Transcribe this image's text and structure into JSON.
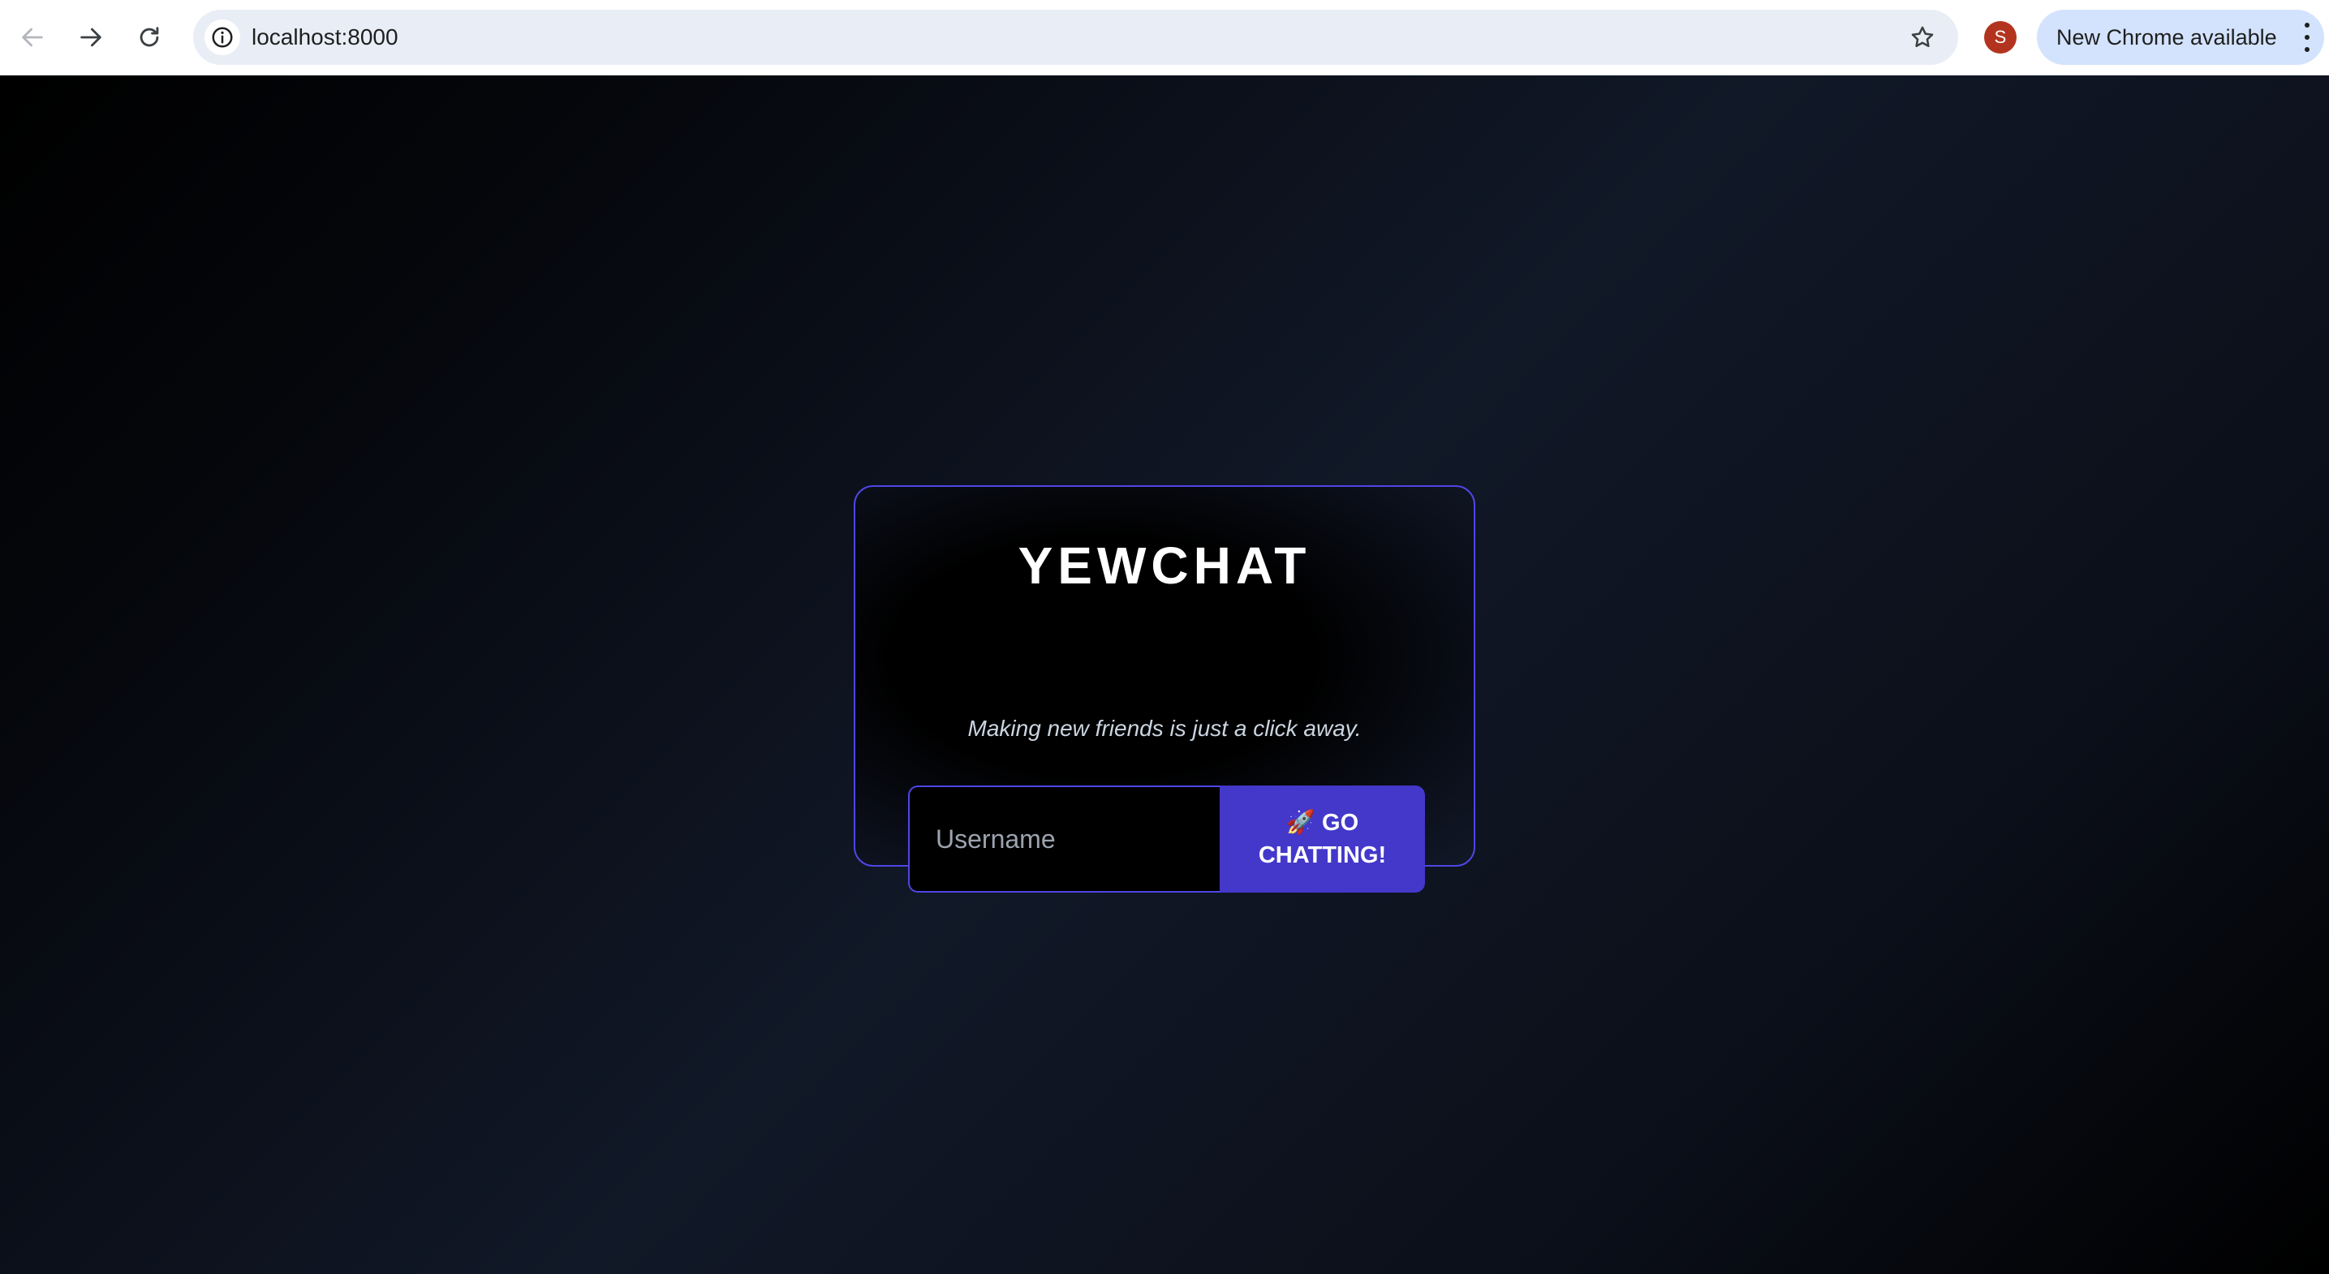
{
  "browser": {
    "url": "localhost:8000",
    "profile_initial": "S",
    "update_label": "New Chrome available",
    "icons": {
      "back": "arrow-left-icon",
      "forward": "arrow-right-icon",
      "reload": "reload-icon",
      "site_info": "info-icon",
      "bookmark": "star-icon",
      "menu": "kebab-menu-icon"
    },
    "colors": {
      "omnibox": "#e9eef6",
      "update_pill": "#d3e3fd",
      "avatar": "#b3341e"
    }
  },
  "page": {
    "title": "YEWCHAT",
    "subtitle": "Making new friends is just a click away.",
    "username_placeholder": "Username",
    "username_value": "",
    "submit_label": "🚀 GO CHATTING!",
    "colors": {
      "accent": "#4f46e5",
      "button": "#4338ca",
      "background": "#111827"
    }
  }
}
